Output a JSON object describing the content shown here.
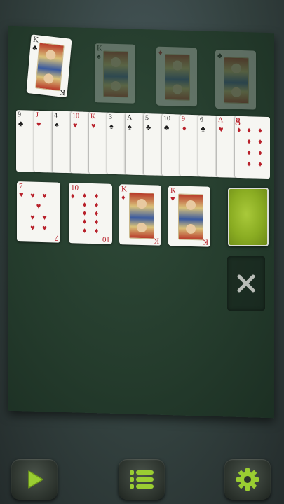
{
  "foundations": [
    {
      "rank": "K",
      "suit": "♣",
      "color": "black",
      "state": "placed"
    },
    {
      "rank": "K",
      "suit": "♠",
      "color": "black",
      "state": "placeholder"
    },
    {
      "rank": "",
      "suit": "♦",
      "color": "red",
      "state": "placeholder"
    },
    {
      "rank": "",
      "suit": "♣",
      "color": "black",
      "state": "placeholder"
    }
  ],
  "fan_row": [
    {
      "rank": "9",
      "suit": "♣",
      "color": "black"
    },
    {
      "rank": "J",
      "suit": "♥",
      "color": "red"
    },
    {
      "rank": "4",
      "suit": "♠",
      "color": "black"
    },
    {
      "rank": "10",
      "suit": "♥",
      "color": "red"
    },
    {
      "rank": "K",
      "suit": "♥",
      "color": "red"
    },
    {
      "rank": "3",
      "suit": "♠",
      "color": "black"
    },
    {
      "rank": "A",
      "suit": "♠",
      "color": "black"
    },
    {
      "rank": "5",
      "suit": "♣",
      "color": "black"
    },
    {
      "rank": "10",
      "suit": "♣",
      "color": "black"
    },
    {
      "rank": "9",
      "suit": "♦",
      "color": "red"
    },
    {
      "rank": "6",
      "suit": "♣",
      "color": "black"
    },
    {
      "rank": "A",
      "suit": "♥",
      "color": "red"
    },
    {
      "rank": "8",
      "suit": "♦",
      "color": "red"
    }
  ],
  "tableau": [
    {
      "rank": "7",
      "suit": "♥",
      "color": "red"
    },
    {
      "rank": "10",
      "suit": "♦",
      "color": "red"
    },
    {
      "rank": "K",
      "suit": "♦",
      "color": "red"
    },
    {
      "rank": "K",
      "suit": "♥",
      "color": "red"
    }
  ],
  "empty_slot_icon": "close-x-icon",
  "colors": {
    "accent": "#9acd32",
    "felt": "#243b2c",
    "red_suit": "#b8202a"
  },
  "toolbar": [
    {
      "icon": "play-icon",
      "name": "play-button"
    },
    {
      "icon": "menu-list-icon",
      "name": "menu-button"
    },
    {
      "icon": "gear-icon",
      "name": "settings-button"
    }
  ]
}
